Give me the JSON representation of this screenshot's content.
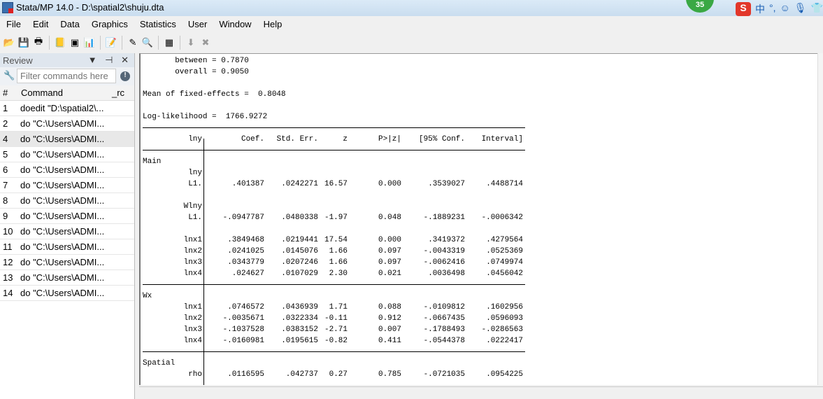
{
  "window": {
    "title": "Stata/MP 14.0 - D:\\spatial2\\shuju.dta",
    "badge": "35",
    "tray": [
      "S",
      "中",
      "°,",
      "☺",
      "🎙",
      "👕"
    ]
  },
  "menu": [
    "File",
    "Edit",
    "Data",
    "Graphics",
    "Statistics",
    "User",
    "Window",
    "Help"
  ],
  "toolbar": [
    "open-icon",
    "save-icon",
    "print-icon",
    "log-icon",
    "viewer-icon",
    "graph-icon",
    "do-file-editor-icon",
    "data-editor-icon",
    "data-browser-icon",
    "variables-manager-icon",
    "more-icon",
    "break-icon"
  ],
  "review": {
    "title": "Review",
    "controls": "▼ ⊣ ✕",
    "filter_placeholder": "Filter commands here",
    "columns": {
      "num": "#",
      "command": "Command",
      "rc": "_rc"
    },
    "rows": [
      {
        "n": "1",
        "cmd": "doedit \"D:\\spatial2\\..."
      },
      {
        "n": "2",
        "cmd": "do \"C:\\Users\\ADMI..."
      },
      {
        "n": "4",
        "cmd": "do \"C:\\Users\\ADMI..."
      },
      {
        "n": "5",
        "cmd": "do \"C:\\Users\\ADMI..."
      },
      {
        "n": "6",
        "cmd": "do \"C:\\Users\\ADMI..."
      },
      {
        "n": "7",
        "cmd": "do \"C:\\Users\\ADMI..."
      },
      {
        "n": "8",
        "cmd": "do \"C:\\Users\\ADMI..."
      },
      {
        "n": "9",
        "cmd": "do \"C:\\Users\\ADMI..."
      },
      {
        "n": "10",
        "cmd": "do \"C:\\Users\\ADMI..."
      },
      {
        "n": "11",
        "cmd": "do \"C:\\Users\\ADMI..."
      },
      {
        "n": "12",
        "cmd": "do \"C:\\Users\\ADMI..."
      },
      {
        "n": "13",
        "cmd": "do \"C:\\Users\\ADMI..."
      },
      {
        "n": "14",
        "cmd": "do \"C:\\Users\\ADMI..."
      }
    ],
    "selected_row": "4"
  },
  "results": {
    "header_lines": [
      "       between = 0.7870",
      "       overall = 0.9050",
      "",
      "Mean of fixed-effects =  0.8048",
      "",
      "Log-likelihood =  1766.9272"
    ],
    "table_header": [
      "lny",
      "Coef.",
      "Std. Err.",
      "z",
      "P>|z|",
      "[95% Conf.",
      "Interval]"
    ],
    "rows": [
      {
        "group": "Main"
      },
      {
        "label": "lny"
      },
      {
        "label": "L1.",
        "v": [
          ".401387",
          ".0242271",
          "16.57",
          "0.000",
          ".3539027",
          ".4488714"
        ]
      },
      {
        "blank": true
      },
      {
        "label": "Wlny"
      },
      {
        "label": "L1.",
        "v": [
          "-.0947787",
          ".0480338",
          "-1.97",
          "0.048",
          "-.1889231",
          "-.0006342"
        ]
      },
      {
        "blank": true
      },
      {
        "label": "lnx1",
        "v": [
          ".3849468",
          ".0219441",
          "17.54",
          "0.000",
          ".3419372",
          ".4279564"
        ]
      },
      {
        "label": "lnx2",
        "v": [
          ".0241025",
          ".0145076",
          "1.66",
          "0.097",
          "-.0043319",
          ".0525369"
        ]
      },
      {
        "label": "lnx3",
        "v": [
          ".0343779",
          ".0207246",
          "1.66",
          "0.097",
          "-.0062416",
          ".0749974"
        ]
      },
      {
        "label": "lnx4",
        "v": [
          ".024627",
          ".0107029",
          "2.30",
          "0.021",
          ".0036498",
          ".0456042"
        ]
      },
      {
        "rule": true
      },
      {
        "group": "Wx"
      },
      {
        "label": "lnx1",
        "v": [
          ".0746572",
          ".0436939",
          "1.71",
          "0.088",
          "-.0109812",
          ".1602956"
        ]
      },
      {
        "label": "lnx2",
        "v": [
          "-.0035671",
          ".0322334",
          "-0.11",
          "0.912",
          "-.0667435",
          ".0596093"
        ]
      },
      {
        "label": "lnx3",
        "v": [
          "-.1037528",
          ".0383152",
          "-2.71",
          "0.007",
          "-.1788493",
          "-.0286563"
        ]
      },
      {
        "label": "lnx4",
        "v": [
          "-.0160981",
          ".0195615",
          "-0.82",
          "0.411",
          "-.0544378",
          ".0222417"
        ]
      },
      {
        "rule": true
      },
      {
        "group": "Spatial"
      },
      {
        "label": "rho",
        "v": [
          ".0116595",
          ".042737",
          "0.27",
          "0.785",
          "-.0721035",
          ".0954225"
        ]
      },
      {
        "rule": true
      }
    ]
  }
}
